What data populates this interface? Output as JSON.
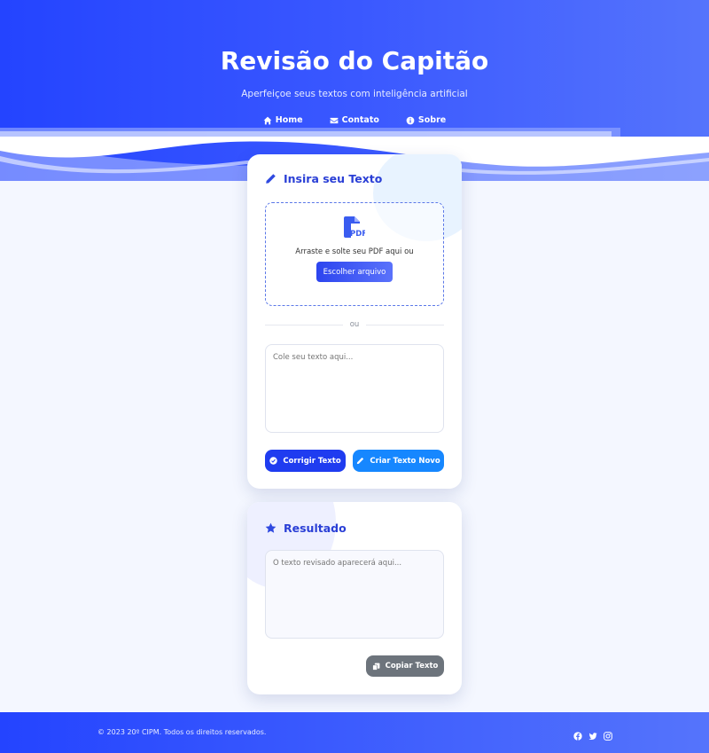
{
  "header": {
    "title": "Revisão do Capitão",
    "subtitle": "Aperfeiçoe seus textos com inteligência artificial",
    "nav": [
      {
        "label": "Home",
        "icon": "home-icon"
      },
      {
        "label": "Contato",
        "icon": "envelope-icon"
      },
      {
        "label": "Sobre",
        "icon": "info-icon"
      }
    ]
  },
  "input_card": {
    "title": "Insira seu Texto",
    "icon": "pencil-icon",
    "drop_text": "Arraste e solte seu PDF aqui ou",
    "choose_label": "Escolher arquivo",
    "divider_text": "ou",
    "textarea_placeholder": "Cole seu texto aqui...",
    "correct_label": "Corrigir Texto",
    "new_label": "Criar Texto Novo"
  },
  "result_card": {
    "title": "Resultado",
    "icon": "star-icon",
    "textarea_placeholder": "O texto revisado aparecerá aqui...",
    "copy_label": "Copiar Texto"
  },
  "footer": {
    "text": "© 2023 20º CIPM. Todos os direitos reservados.",
    "socials": [
      "facebook-icon",
      "twitter-icon",
      "instagram-icon"
    ]
  },
  "colors": {
    "primary": "#2444ff",
    "accent": "#1687ff",
    "gray_button": "#6d747c",
    "background": "#f4f7ff"
  }
}
